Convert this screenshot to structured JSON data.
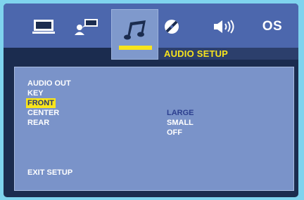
{
  "tabs": [
    {
      "icon": "monitor-icon"
    },
    {
      "icon": "person-speech-icon"
    },
    {
      "icon": "music-note-icon",
      "selected": true
    },
    {
      "icon": "disc-icon"
    },
    {
      "icon": "speaker-icon"
    },
    {
      "label": "OS"
    }
  ],
  "section_title": "AUDIO SETUP",
  "menu": {
    "items": [
      "AUDIO OUT",
      "KEY",
      "FRONT",
      "CENTER",
      "REAR"
    ],
    "highlighted": "FRONT",
    "exit_label": "EXIT SETUP"
  },
  "options": {
    "values": [
      "LARGE",
      "SMALL",
      "OFF"
    ],
    "active": "LARGE"
  },
  "colors": {
    "background": "#7fd3ee",
    "frame": "#1b2c4f",
    "menu_bar": "#4c67ad",
    "panel": "#7a93c9",
    "highlight": "#f8e41c",
    "active_value": "#2c3f8f"
  }
}
